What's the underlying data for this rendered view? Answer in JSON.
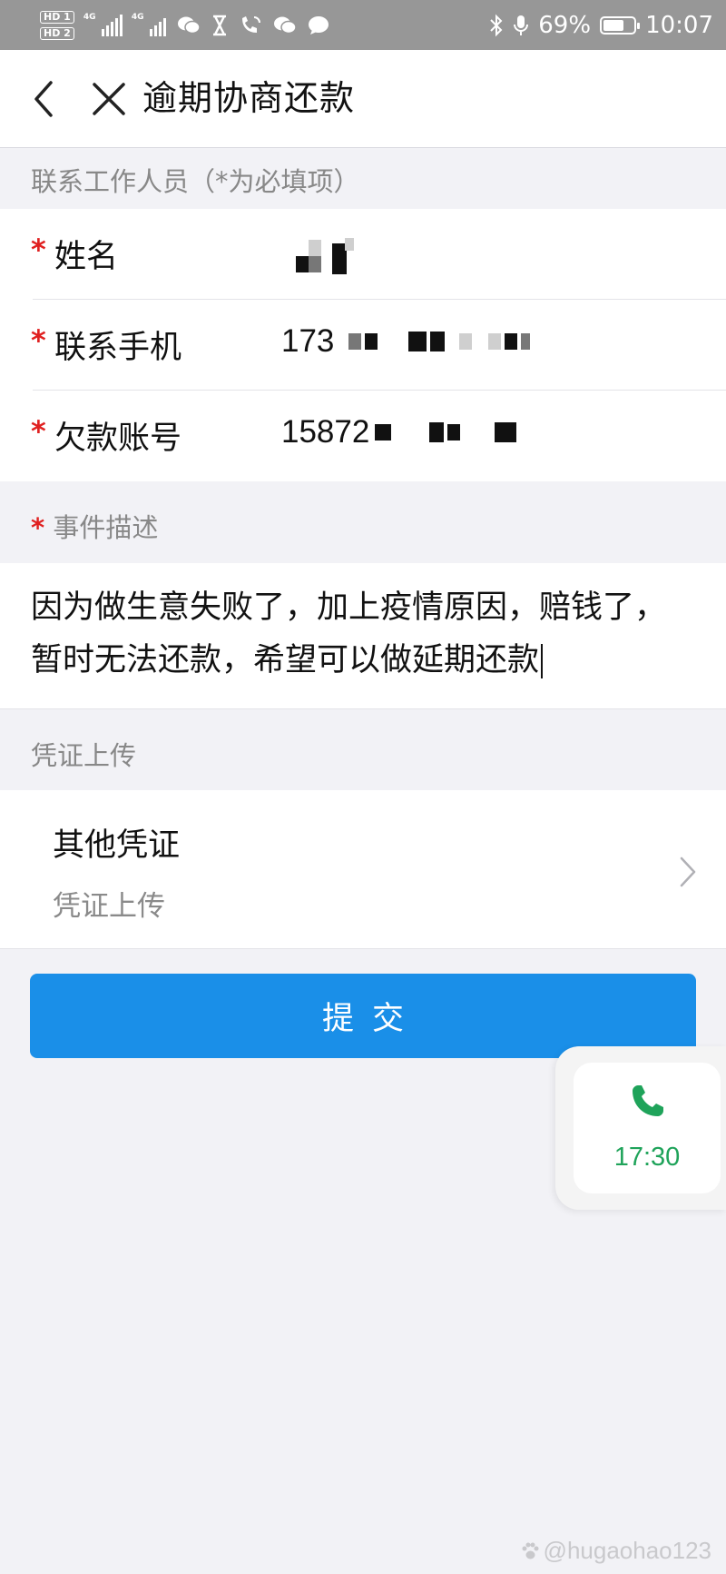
{
  "status_bar": {
    "hd1": "HD 1",
    "hd2": "HD 2",
    "net1": "4G",
    "net2": "4G",
    "battery_percent": "69%",
    "battery_level": 0.69,
    "time": "10:07"
  },
  "nav": {
    "title": "逾期协商还款"
  },
  "contact_section": {
    "header": "联系工作人员（*为必填项）",
    "fields": [
      {
        "label": "姓名",
        "required": true,
        "value": ""
      },
      {
        "label": "联系手机",
        "required": true,
        "value": "173"
      },
      {
        "label": "欠款账号",
        "required": true,
        "value": "15872"
      }
    ]
  },
  "description_section": {
    "header": "事件描述",
    "required_mark": "*",
    "text": "因为做生意失败了，加上疫情原因，赔钱了，暂时无法还款，希望可以做延期还款"
  },
  "voucher_section": {
    "header": "凭证上传",
    "item_title": "其他凭证",
    "item_subtitle": "凭证上传"
  },
  "submit": {
    "label": "提交"
  },
  "call_widget": {
    "time": "17:30",
    "color": "#1fa35a"
  },
  "watermark": {
    "text": "@hugaohao123"
  },
  "colors": {
    "accent": "#1a8fe8",
    "required": "#e02020"
  }
}
